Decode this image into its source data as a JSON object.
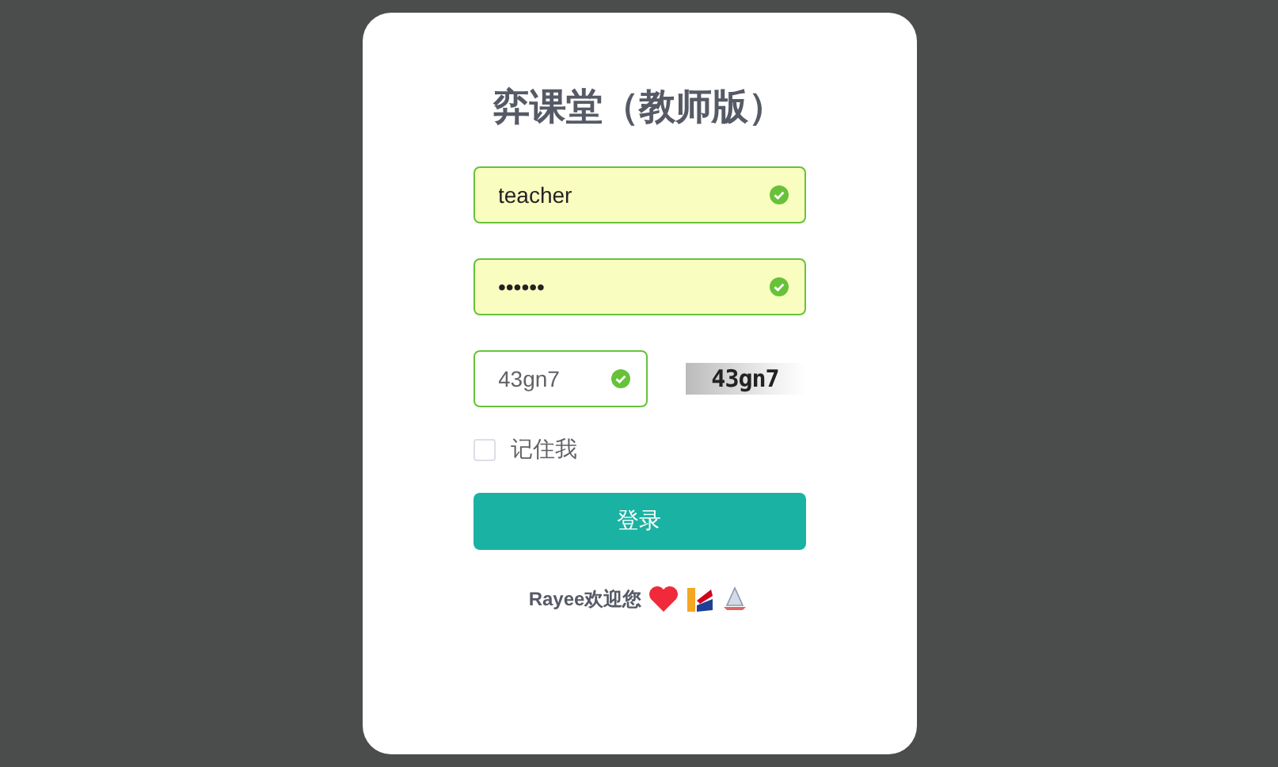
{
  "title": "弈课堂（教师版）",
  "fields": [
    {
      "kind": "text",
      "value": "teacher",
      "valid": true
    },
    {
      "kind": "password",
      "value": "••••••",
      "valid": true
    },
    {
      "kind": "captcha",
      "value": "43gn7",
      "valid": true,
      "captcha_text": "43gn7"
    }
  ],
  "remember": {
    "label": "记住我",
    "checked": false
  },
  "login_button": "登录",
  "footer": {
    "text": "Rayee欢迎您"
  }
}
